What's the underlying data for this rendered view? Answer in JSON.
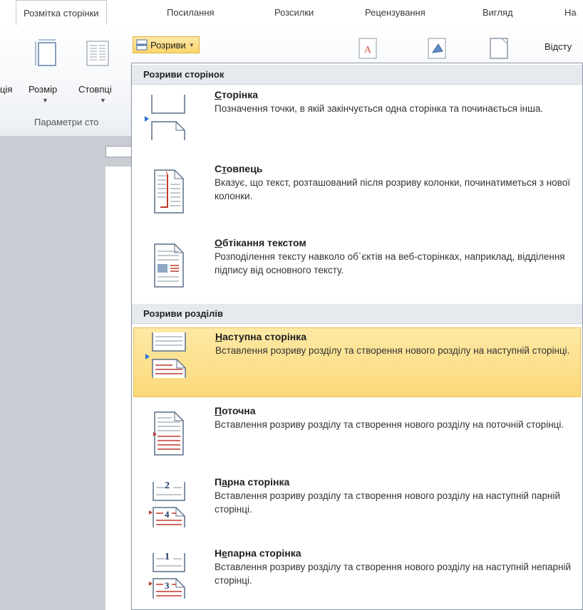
{
  "ribbon": {
    "tabs": [
      {
        "label": "Розмітка сторінки",
        "active": true
      },
      {
        "label": "Посилання"
      },
      {
        "label": "Розсилки"
      },
      {
        "label": "Рецензування"
      },
      {
        "label": "Вигляд"
      },
      {
        "label": "На"
      }
    ],
    "buttons": {
      "orientation_partial": "ція",
      "size": "Розмір",
      "columns": "Стовпці",
      "breaks": "Розриви",
      "spacing_partial": "Відсту"
    },
    "group_label": "Параметри сто"
  },
  "menu": {
    "sections": [
      {
        "header": "Розриви сторінок",
        "items": [
          {
            "name": "page",
            "title_key": "С",
            "title_rest": "торінка",
            "description": "Позначення точки, в якій закінчується одна сторінка та починається інша."
          },
          {
            "name": "column",
            "title_pre": "С",
            "title_key": "т",
            "title_rest": "овпець",
            "description": "Вказує, що текст, розташований після розриву колонки, починатиметься з нової колонки."
          },
          {
            "name": "text-wrapping",
            "title_key": "О",
            "title_rest": "бтікання текстом",
            "description": "Розподілення тексту навколо об`єктів на веб-сторінках, наприклад, відділення підпису від основного тексту."
          }
        ]
      },
      {
        "header": "Розриви розділів",
        "items": [
          {
            "name": "next-page",
            "title_key": "Н",
            "title_rest": "аступна сторінка",
            "description": "Вставлення розриву розділу та створення нового розділу на наступній сторінці.",
            "highlighted": true
          },
          {
            "name": "continuous",
            "title_key": "П",
            "title_rest": "оточна",
            "description": "Вставлення розриву розділу та створення нового розділу на поточній сторінці."
          },
          {
            "name": "even-page",
            "title_pre": "П",
            "title_key": "а",
            "title_rest": "рна сторінка",
            "description": "Вставлення розриву розділу та створення нового розділу на наступній парній сторінці.",
            "badge": "2",
            "badge_lower": "4"
          },
          {
            "name": "odd-page",
            "title_pre": "Н",
            "title_key": "е",
            "title_rest": "парна сторінка",
            "description": "Вставлення розриву розділу та створення нового розділу на наступній непарній сторінці.",
            "badge": "1",
            "badge_lower": "3"
          }
        ]
      }
    ]
  },
  "colors": {
    "highlight": "#fbd97a",
    "accent_red": "#c0392b",
    "accent_blue": "#2e6fd8"
  }
}
